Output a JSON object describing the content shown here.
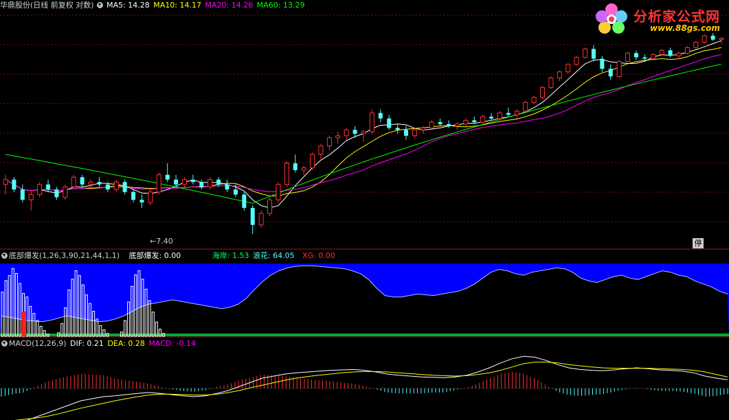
{
  "main_header": {
    "stock_title": "华鼎股份(日线 前复权 对数)",
    "ma5": "MA5: 14.28",
    "ma10": "MA10: 14.17",
    "ma20": "MA20: 14.26",
    "ma60": "MA60: 13.29"
  },
  "low_label": "7.40",
  "stop_badge": "停",
  "logo": {
    "title": "分析家公式网",
    "url": "www.88gs.com"
  },
  "indicator_header": {
    "name": "底部爆发(1,26,3,90,21,44,1,1)",
    "value": "底部爆发: 0.00",
    "haian": "海岸: 1.53",
    "langhua": "浪花: 64.05",
    "xg": "XG: 0.00"
  },
  "macd_header": {
    "name": "MACD(12,26,9)",
    "dif": "DIF: 0.21",
    "dea": "DEA: 0.28",
    "macd": "MACD: -0.14"
  },
  "colors": {
    "up": "#ff3232",
    "down": "#54ffff",
    "ma5": "#ffffff",
    "ma10": "#ffff00",
    "ma20": "#ff00ff",
    "ma60": "#00ff00",
    "blue_fill": "#0000ff",
    "bars": "#ffffff"
  },
  "chart_data": [
    {
      "type": "candlestick",
      "title": "华鼎股份(日线 前复权 对数)",
      "min_low": 7.4,
      "series": [
        {
          "name": "MA5",
          "last": 14.28
        },
        {
          "name": "MA10",
          "last": 14.17
        },
        {
          "name": "MA20",
          "last": 14.26
        },
        {
          "name": "MA60",
          "last": 13.29
        }
      ],
      "ohlc": [
        [
          9.2,
          9.6,
          8.8,
          9.4
        ],
        [
          9.4,
          9.5,
          8.9,
          9.0
        ],
        [
          9.0,
          9.2,
          8.5,
          8.6
        ],
        [
          8.6,
          8.9,
          8.2,
          8.8
        ],
        [
          8.8,
          9.3,
          8.7,
          9.2
        ],
        [
          9.2,
          9.4,
          8.9,
          9.0
        ],
        [
          9.0,
          9.1,
          8.6,
          8.7
        ],
        [
          8.7,
          9.2,
          8.6,
          9.1
        ],
        [
          9.1,
          9.6,
          9.0,
          9.5
        ],
        [
          9.5,
          9.6,
          9.1,
          9.2
        ],
        [
          9.2,
          9.4,
          9.0,
          9.3
        ],
        [
          9.3,
          9.5,
          9.1,
          9.2
        ],
        [
          9.2,
          9.3,
          8.9,
          9.0
        ],
        [
          9.0,
          9.4,
          8.9,
          9.3
        ],
        [
          9.3,
          9.4,
          8.8,
          8.9
        ],
        [
          8.9,
          9.0,
          8.5,
          8.6
        ],
        [
          8.6,
          8.8,
          8.3,
          8.5
        ],
        [
          8.5,
          9.0,
          8.4,
          8.9
        ],
        [
          8.9,
          9.7,
          8.8,
          9.6
        ],
        [
          9.6,
          10.1,
          9.3,
          9.4
        ],
        [
          9.4,
          9.6,
          9.1,
          9.2
        ],
        [
          9.2,
          9.5,
          9.1,
          9.4
        ],
        [
          9.4,
          9.6,
          9.2,
          9.3
        ],
        [
          9.3,
          9.4,
          9.0,
          9.1
        ],
        [
          9.1,
          9.5,
          9.0,
          9.4
        ],
        [
          9.4,
          9.5,
          9.1,
          9.2
        ],
        [
          9.2,
          9.4,
          8.9,
          9.0
        ],
        [
          9.0,
          9.2,
          8.7,
          8.8
        ],
        [
          8.8,
          8.9,
          8.2,
          8.3
        ],
        [
          8.3,
          8.4,
          7.4,
          7.7
        ],
        [
          7.7,
          8.2,
          7.6,
          8.1
        ],
        [
          8.1,
          8.7,
          8.0,
          8.6
        ],
        [
          8.6,
          9.3,
          8.5,
          9.2
        ],
        [
          9.2,
          10.2,
          9.1,
          10.1
        ],
        [
          10.1,
          10.5,
          9.7,
          9.8
        ],
        [
          9.8,
          10.0,
          9.6,
          9.9
        ],
        [
          9.9,
          10.6,
          9.8,
          10.5
        ],
        [
          10.5,
          11.0,
          10.3,
          10.9
        ],
        [
          10.9,
          11.4,
          10.7,
          11.3
        ],
        [
          11.3,
          11.6,
          11.0,
          11.4
        ],
        [
          11.4,
          11.8,
          11.2,
          11.7
        ],
        [
          11.7,
          11.9,
          11.3,
          11.5
        ],
        [
          11.5,
          11.7,
          11.1,
          11.6
        ],
        [
          11.6,
          12.8,
          11.5,
          12.6
        ],
        [
          12.6,
          12.8,
          12.1,
          12.3
        ],
        [
          12.3,
          12.5,
          11.7,
          11.8
        ],
        [
          11.8,
          12.0,
          11.5,
          11.7
        ],
        [
          11.7,
          11.9,
          11.2,
          11.4
        ],
        [
          11.4,
          11.8,
          11.3,
          11.7
        ],
        [
          11.7,
          11.9,
          11.5,
          11.8
        ],
        [
          11.8,
          12.2,
          11.7,
          12.1
        ],
        [
          12.1,
          12.3,
          11.9,
          12.0
        ],
        [
          12.0,
          12.2,
          11.8,
          11.9
        ],
        [
          11.9,
          12.1,
          11.7,
          12.0
        ],
        [
          12.0,
          12.3,
          11.9,
          12.2
        ],
        [
          12.2,
          12.4,
          12.0,
          12.1
        ],
        [
          12.1,
          12.5,
          12.0,
          12.4
        ],
        [
          12.4,
          12.6,
          12.2,
          12.3
        ],
        [
          12.3,
          12.7,
          12.2,
          12.6
        ],
        [
          12.6,
          12.9,
          12.4,
          12.5
        ],
        [
          12.5,
          12.8,
          12.3,
          12.7
        ],
        [
          12.7,
          13.3,
          12.6,
          13.2
        ],
        [
          13.2,
          13.6,
          13.1,
          13.5
        ],
        [
          13.5,
          14.2,
          13.4,
          14.1
        ],
        [
          14.1,
          14.8,
          14.0,
          14.7
        ],
        [
          14.7,
          15.2,
          14.5,
          15.1
        ],
        [
          15.1,
          15.7,
          15.0,
          15.6
        ],
        [
          15.6,
          16.2,
          15.5,
          16.1
        ],
        [
          16.1,
          16.8,
          16.0,
          16.7
        ],
        [
          16.7,
          17.0,
          15.8,
          16.0
        ],
        [
          16.0,
          16.2,
          15.1,
          15.3
        ],
        [
          15.3,
          15.6,
          14.6,
          14.8
        ],
        [
          14.8,
          15.9,
          14.7,
          15.8
        ],
        [
          15.8,
          16.5,
          15.7,
          16.4
        ],
        [
          16.4,
          16.6,
          15.9,
          16.1
        ],
        [
          16.1,
          16.3,
          15.8,
          16.0
        ],
        [
          16.0,
          16.4,
          15.9,
          16.3
        ],
        [
          16.3,
          16.7,
          16.2,
          16.6
        ],
        [
          16.6,
          16.8,
          16.1,
          16.2
        ],
        [
          16.2,
          16.5,
          16.0,
          16.4
        ],
        [
          16.4,
          16.9,
          16.3,
          16.8
        ],
        [
          16.8,
          17.3,
          16.7,
          17.2
        ],
        [
          17.2,
          17.8,
          17.1,
          17.7
        ],
        [
          17.7,
          17.9,
          17.3,
          17.4
        ],
        [
          17.4,
          17.6,
          17.1,
          17.5
        ]
      ]
    },
    {
      "type": "bar+line",
      "title": "底部爆发(1,26,3,90,21,44,1,1)",
      "series": [
        {
          "name": "底部爆发",
          "last": 0.0
        },
        {
          "name": "海岸",
          "last": 1.53
        },
        {
          "name": "浪花",
          "last": 64.05
        },
        {
          "name": "XG",
          "last": 0.0
        }
      ],
      "bar_values": [
        62,
        78,
        85,
        95,
        88,
        74,
        60,
        55,
        42,
        32,
        22,
        14,
        8,
        3,
        0,
        0,
        5,
        18,
        40,
        65,
        80,
        92,
        85,
        72,
        58,
        46,
        35,
        24,
        15,
        9,
        4,
        0,
        0,
        0,
        6,
        22,
        48,
        70,
        86,
        92,
        80,
        66,
        50,
        34,
        20,
        10,
        4,
        0,
        0,
        0
      ],
      "langhua_values": [
        28,
        26,
        24,
        22,
        21,
        20,
        22,
        25,
        28,
        26,
        24,
        22,
        20,
        21,
        24,
        28,
        34,
        40,
        44,
        46,
        48,
        50,
        48,
        46,
        44,
        42,
        40,
        38,
        40,
        44,
        52,
        64,
        75,
        84,
        90,
        94,
        96,
        97,
        97,
        96,
        95,
        94,
        93,
        90,
        86,
        78,
        66,
        56,
        54,
        54,
        56,
        58,
        57,
        56,
        58,
        60,
        62,
        66,
        72,
        80,
        88,
        92,
        90,
        86,
        84,
        88,
        90,
        92,
        94,
        93,
        88,
        80,
        76,
        74,
        78,
        82,
        84,
        80,
        78,
        82,
        86,
        90,
        88,
        84,
        82,
        76,
        72,
        68,
        62,
        58
      ]
    },
    {
      "type": "macd",
      "title": "MACD(12,26,9)",
      "series": [
        {
          "name": "DIF",
          "last": 0.21
        },
        {
          "name": "DEA",
          "last": 0.28
        },
        {
          "name": "MACD",
          "last": -0.14
        }
      ],
      "dif": [
        -0.9,
        -0.85,
        -0.8,
        -0.7,
        -0.6,
        -0.5,
        -0.4,
        -0.3,
        -0.25,
        -0.2,
        -0.18,
        -0.15,
        -0.12,
        -0.1,
        -0.12,
        -0.15,
        -0.18,
        -0.2,
        -0.18,
        -0.12,
        -0.05,
        0.05,
        0.15,
        0.25,
        0.3,
        0.35,
        0.38,
        0.4,
        0.42,
        0.44,
        0.45,
        0.46,
        0.44,
        0.4,
        0.35,
        0.32,
        0.3,
        0.28,
        0.27,
        0.26,
        0.28,
        0.32,
        0.4,
        0.5,
        0.62,
        0.72,
        0.78,
        0.76,
        0.68,
        0.58,
        0.5,
        0.46,
        0.44,
        0.43,
        0.45,
        0.48,
        0.5,
        0.48,
        0.45,
        0.44,
        0.42,
        0.38,
        0.3,
        0.25,
        0.21
      ],
      "dea": [
        -0.8,
        -0.78,
        -0.75,
        -0.72,
        -0.68,
        -0.62,
        -0.55,
        -0.48,
        -0.42,
        -0.36,
        -0.3,
        -0.25,
        -0.2,
        -0.16,
        -0.14,
        -0.14,
        -0.15,
        -0.16,
        -0.16,
        -0.14,
        -0.1,
        -0.05,
        0.02,
        0.08,
        0.14,
        0.2,
        0.25,
        0.29,
        0.32,
        0.35,
        0.38,
        0.4,
        0.41,
        0.41,
        0.4,
        0.38,
        0.36,
        0.34,
        0.32,
        0.31,
        0.3,
        0.31,
        0.34,
        0.38,
        0.44,
        0.52,
        0.6,
        0.64,
        0.64,
        0.62,
        0.58,
        0.55,
        0.52,
        0.5,
        0.49,
        0.49,
        0.49,
        0.49,
        0.48,
        0.47,
        0.46,
        0.44,
        0.4,
        0.34,
        0.28
      ]
    }
  ]
}
